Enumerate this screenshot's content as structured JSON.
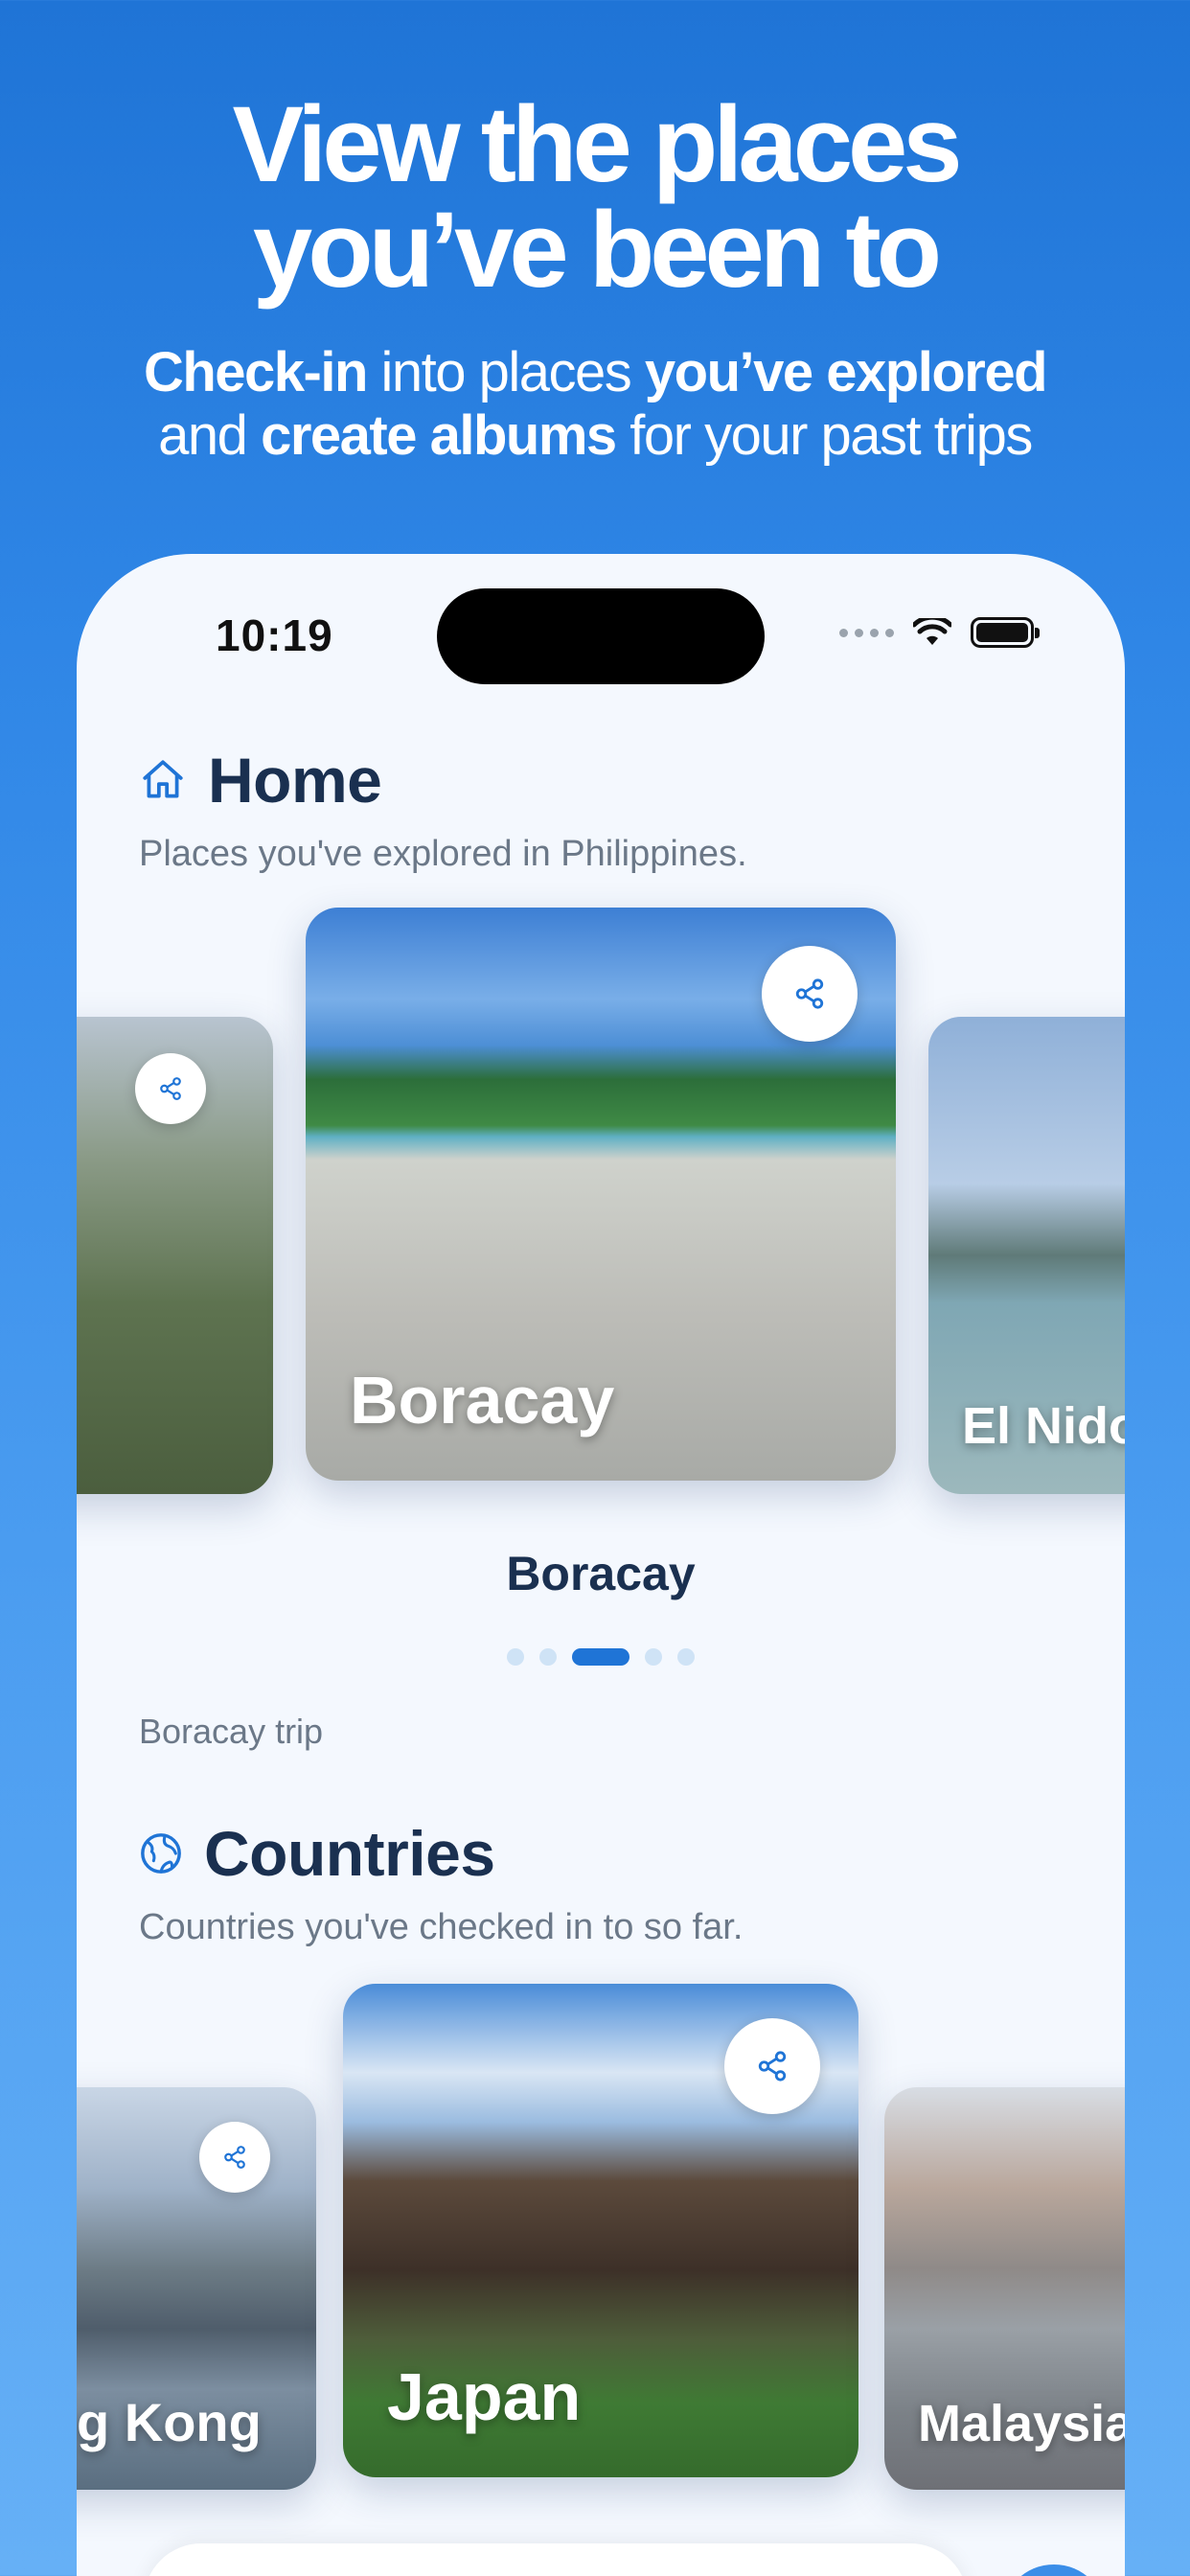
{
  "promo": {
    "title_line1": "View the places",
    "title_line2": "you’ve been to",
    "sub_b1": "Check-in",
    "sub_t1": " into places ",
    "sub_b2": "you’ve explored",
    "sub_t2": "and ",
    "sub_b3": "create albums",
    "sub_t3": " for your past trips"
  },
  "status_bar": {
    "time": "10:19"
  },
  "home": {
    "title": "Home",
    "icon": "home-icon",
    "description": "Places you've explored in Philippines.",
    "cards": [
      "",
      "Boracay",
      "El Nido"
    ],
    "selected_title": "Boracay",
    "pager": {
      "count": 5,
      "active_index": 2
    },
    "trip_label": "Boracay trip"
  },
  "countries": {
    "title": "Countries",
    "icon": "globe-icon",
    "description": "Countries you've checked in to so far.",
    "cards": [
      "g Kong",
      "Japan",
      "Malaysia"
    ]
  },
  "colors": {
    "accent": "#1f74d6",
    "heading": "#1a3050",
    "muted": "#6b7888"
  }
}
